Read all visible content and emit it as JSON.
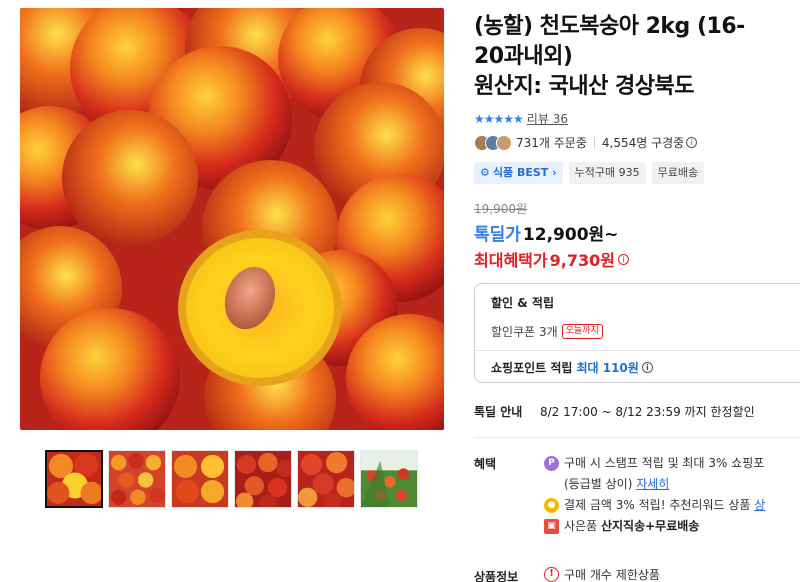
{
  "product": {
    "title_line1": "(농할) 천도복숭아 2kg (16-",
    "title_line2": "20과내외)",
    "title_line3": "원산지: 국내산 경상북도",
    "stars": "★★★★★",
    "review_label": "리뷰 36",
    "orders": "731개 주문중",
    "viewers": "4,554명 구경중",
    "badges": {
      "best": "식품 BEST",
      "cumulative": "누적구매 935",
      "shipping": "무료배송"
    }
  },
  "price": {
    "original": "19,900원",
    "sale_label": "톡딜가",
    "sale_price": "12,900원~",
    "max_label": "최대혜택가",
    "max_price": "9,730원"
  },
  "discount_box": {
    "title": "할인 & 적립",
    "coupon": "할인쿠폰 3개",
    "today_tag": "오늘까지",
    "points_label": "쇼핑포인트 적립",
    "points_max": "최대 110원"
  },
  "deal": {
    "label": "톡딜 안내",
    "text": "8/2 17:00 ~ 8/12 23:59 까지 한정할인"
  },
  "benefits": {
    "label": "혜택",
    "item1_text": "구매 시 스탬프 적립 및 최대 3% 쇼핑포",
    "item1_sub": "(등급별 상이)",
    "item1_link": "자세히",
    "item2_text": "결제 금액 3% 적립! 추천리워드 상품",
    "item2_link": "상",
    "item3_prefix": "사은품",
    "item3_bold": "산지직송+무료배송"
  },
  "product_info": {
    "label": "상품정보",
    "text": "구매 개수 제한상품"
  },
  "icons": {
    "star": "star-icon",
    "info": "info-icon",
    "gift": "gift-icon",
    "warning": "warning-icon"
  },
  "colors": {
    "accent_blue": "#2f80ed",
    "price_red": "#e02020"
  }
}
